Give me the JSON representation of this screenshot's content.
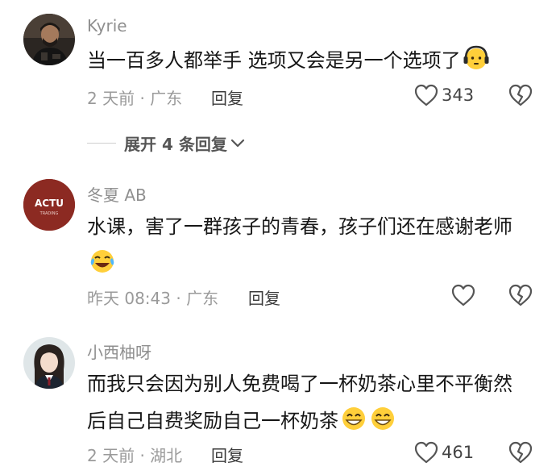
{
  "comments": [
    {
      "username": "Kyrie",
      "text": "当一百多人都举手 选项又会是另一个选项了",
      "emoji_icon": "headphones-face-emoji",
      "time": "2 天前",
      "location": "广东",
      "reply_label": "回复",
      "likes": "343"
    },
    {
      "username": "冬夏 AB",
      "avatar_text": "ACTU",
      "avatar_subtext": "TRADING",
      "text": "水课，害了一群孩子的青春，孩子们还在感谢老师",
      "emoji_icon": "crying-laughing-emoji",
      "time": "昨天 08:43",
      "location": "广东",
      "reply_label": "回复",
      "likes": ""
    },
    {
      "username": "小西柚呀",
      "text": "而我只会因为别人免费喝了一杯奶茶心里不平衡然后自己自费奖励自己一杯奶茶",
      "emoji_icon": "grinning-emoji",
      "time": "2 天前",
      "location": "湖北",
      "reply_label": "回复",
      "likes": "461"
    }
  ],
  "expand_replies_label": "展开 4 条回复",
  "meta_separator": "·",
  "colors": {
    "meta_text": "#9a9a9a",
    "body_text": "#161616",
    "actu_avatar_bg": "#8c2a22",
    "emoji_yellow": "#ffcf3a"
  }
}
